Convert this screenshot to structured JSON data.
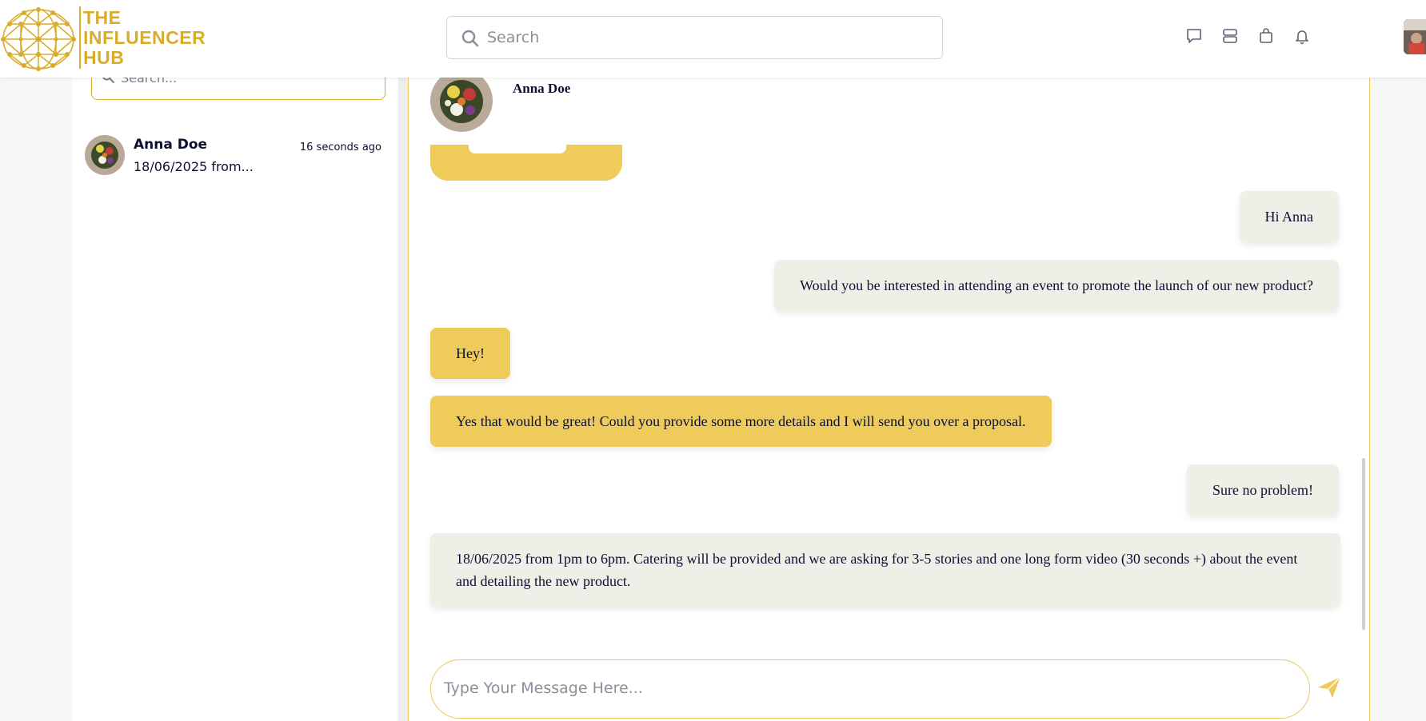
{
  "brand": {
    "logo_lines": [
      "THE",
      "INFLUENCER",
      "HUB"
    ],
    "accent_color": "#d9ad2c"
  },
  "header": {
    "search": {
      "placeholder": "Search",
      "icon": "search-icon"
    },
    "icons": [
      "chat-icon",
      "list-icon",
      "bag-icon",
      "bell-icon"
    ]
  },
  "sidebar": {
    "search": {
      "placeholder": "Search...",
      "icon": "search-icon"
    },
    "conversations": [
      {
        "name": "Anna Doe",
        "time": "16 seconds ago",
        "preview": "18/06/2025 from..."
      }
    ]
  },
  "chat": {
    "contact_name": "Anna Doe",
    "messages": [
      {
        "sender": "me",
        "text": "Hi Anna"
      },
      {
        "sender": "me",
        "text": "Would you be interested in attending an event to promote the launch of our new product?"
      },
      {
        "sender": "them",
        "text": "Hey!"
      },
      {
        "sender": "them",
        "text": "Yes that would be great! Could you provide some more details and I will send you over a proposal."
      },
      {
        "sender": "me",
        "text": "Sure no problem!"
      },
      {
        "sender": "me",
        "text": "18/06/2025 from 1pm to 6pm. Catering will be provided and we are asking for 3-5 stories and one long form video (30 seconds +) about the event and detailing the new product."
      }
    ],
    "composer": {
      "placeholder": "Type Your Message Here...",
      "send_icon": "send-icon"
    }
  },
  "colors": {
    "bubble_me": "#f0efe7",
    "bubble_them": "#eecb5a",
    "border_gold": "#ecc95a"
  }
}
